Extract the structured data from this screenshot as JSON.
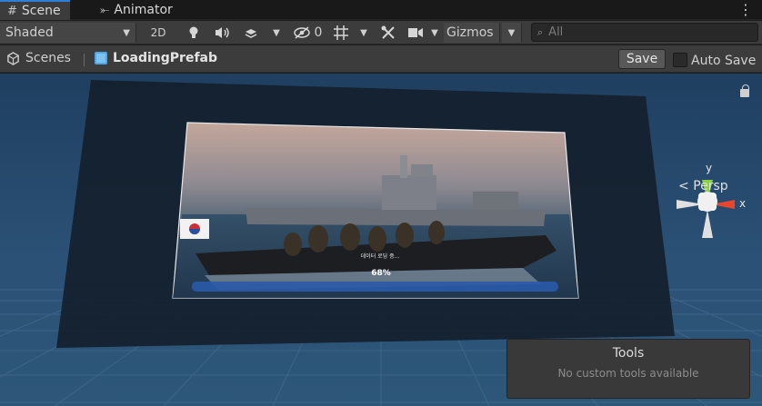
{
  "tabs": [
    {
      "label": "Scene",
      "icon": "grid-icon",
      "active": true
    },
    {
      "label": "Animator",
      "icon": "animator-icon",
      "active": false
    }
  ],
  "toolbar": {
    "shading_mode": "Shaded",
    "mode_2d": "2D",
    "hidden_count": "0",
    "gizmos_label": "Gizmos",
    "search_placeholder": "All"
  },
  "breadcrumb": {
    "root": "Scenes",
    "prefab": "LoadingPrefab",
    "save_label": "Save",
    "autosave_label": "Auto Save",
    "autosave_checked": false
  },
  "viewport": {
    "loading_progress_text": "68%",
    "loading_progress": 0.68,
    "loading_caption": "데이터 로딩 중...",
    "projection_label": "Persp",
    "gizmo_axes": {
      "y": "y",
      "x": "x"
    },
    "axis_colors": {
      "x": "#e8452c",
      "y": "#8bd140",
      "z": "#e0e0e0"
    }
  },
  "tools_panel": {
    "title": "Tools",
    "subtitle": "No custom tools available"
  }
}
